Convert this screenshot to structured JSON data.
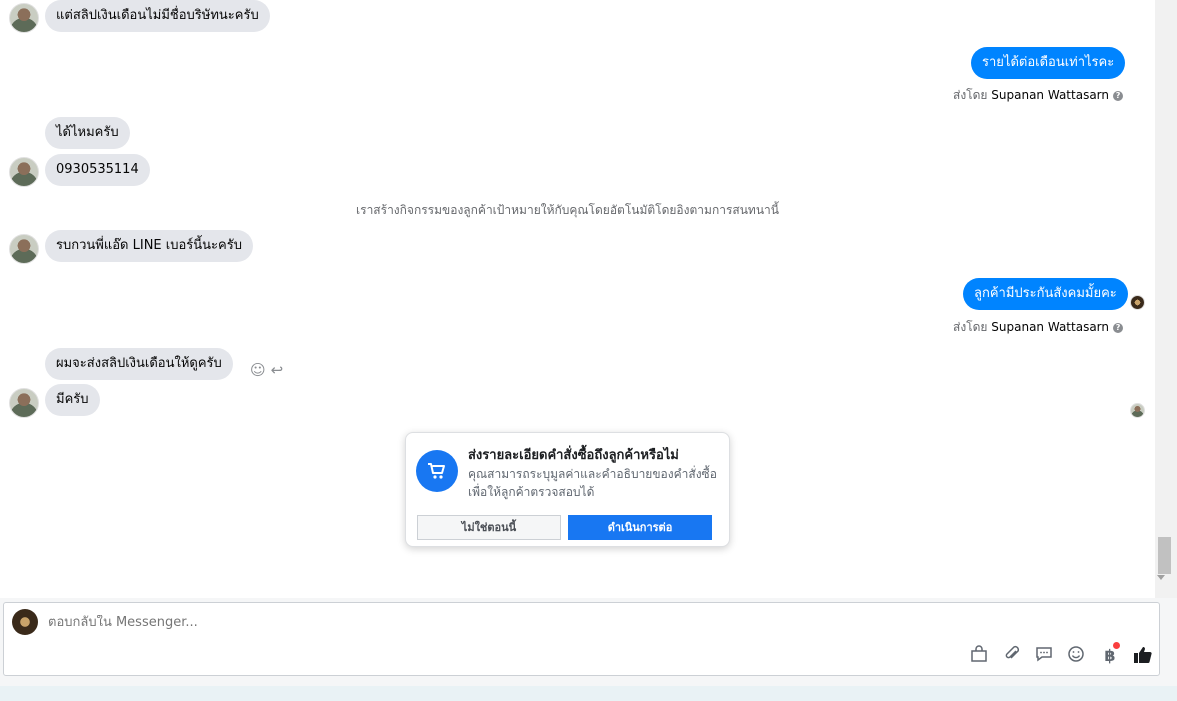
{
  "messages": {
    "m1": "แต่สลิปเงินเดือนไม่มีชื่อบริษัทนะครับ",
    "m2": "รายได้ต่อเดือนเท่าไรคะ",
    "m3": "ได้ไหมครับ",
    "m4": "0930535114",
    "m5": "รบกวนพี่แอ๊ด LINE เบอร์นี้นะครับ",
    "m6": "ลูกค้ามีประกันสังคมมั้ยคะ",
    "m7": "ผมจะส่งสลิปเงินเดือนให้ดูครับ",
    "m8": "มีครับ"
  },
  "sent_by_prefix": "ส่งโดย",
  "sender_name": "Supanan Wattasarn",
  "system_note": "เราสร้างกิจกรรมของลูกค้าเป้าหมายให้กับคุณโดยอัตโนมัติโดยอิงตามการสนทนานี้",
  "popup": {
    "title": "ส่งรายละเอียดคำสั่งซื้อถึงลูกค้าหรือไม่",
    "description": "คุณสามารถระบุมูลค่าและคำอธิบายของคำสั่งซื้อ เพื่อให้ลูกค้าตรวจสอบได้",
    "secondary_button": "ไม่ใช่ตอนนี้",
    "primary_button": "ดำเนินการต่อ"
  },
  "composer": {
    "placeholder": "ตอบกลับใน Messenger..."
  },
  "icons": {
    "smile": "smile-icon",
    "reply": "reply-icon",
    "cart": "cart-icon",
    "shopping_bag": "shopping-bag-icon",
    "attach": "paperclip-icon",
    "saved_reply": "saved-reply-icon",
    "emoji": "emoji-icon",
    "payment": "baht-icon",
    "like": "thumbs-up-icon"
  },
  "colors": {
    "accent": "#0084ff",
    "button_primary": "#1877f2",
    "incoming_bubble": "#e4e6eb",
    "notification_dot": "#fa3e3e"
  }
}
